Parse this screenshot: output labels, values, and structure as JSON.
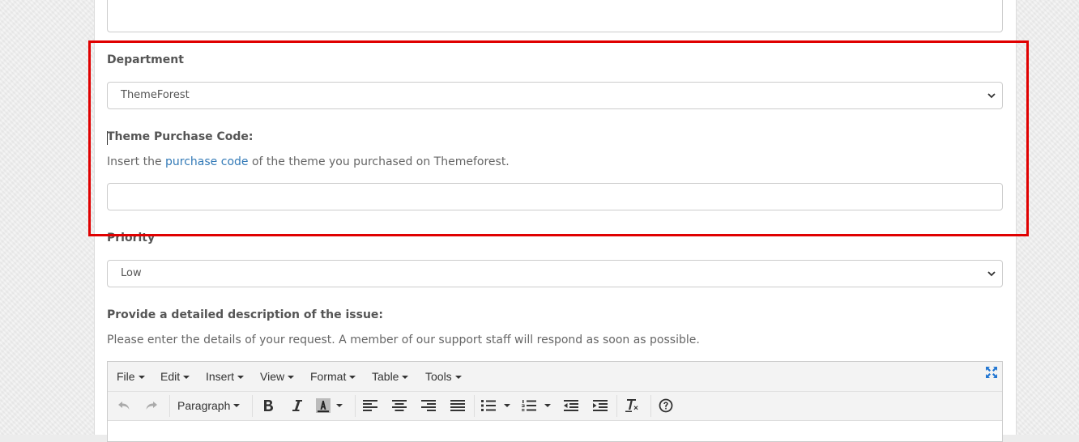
{
  "form": {
    "department": {
      "label": "Department",
      "selected": "ThemeForest"
    },
    "purchase_code": {
      "label": "Theme Purchase Code:",
      "help_prefix": "Insert the ",
      "help_link": "purchase code",
      "help_suffix": " of the theme you purchased on Themeforest.",
      "value": ""
    },
    "priority": {
      "label": "Priority",
      "selected": "Low"
    },
    "description": {
      "label": "Provide a detailed description of the issue:",
      "help": "Please enter the details of your request. A member of our support staff will respond as soon as possible."
    }
  },
  "editor": {
    "menus": [
      "File",
      "Edit",
      "Insert",
      "View",
      "Format",
      "Table",
      "Tools"
    ],
    "block_format": "Paragraph",
    "toolbar_icons": [
      "undo-icon",
      "redo-icon",
      "bold-icon",
      "italic-icon",
      "text-color-icon",
      "align-left-icon",
      "align-center-icon",
      "align-right-icon",
      "align-justify-icon",
      "bullet-list-icon",
      "numbered-list-icon",
      "outdent-icon",
      "indent-icon",
      "clear-formatting-icon",
      "help-icon",
      "fullscreen-icon"
    ]
  },
  "colors": {
    "highlight": "#e00000",
    "link": "#337ab7",
    "fullscreen_icon": "#2276d2"
  }
}
